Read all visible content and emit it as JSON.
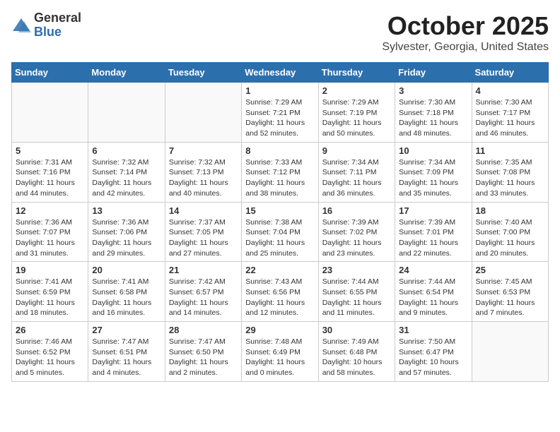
{
  "header": {
    "logo_general": "General",
    "logo_blue": "Blue",
    "month": "October 2025",
    "location": "Sylvester, Georgia, United States"
  },
  "weekdays": [
    "Sunday",
    "Monday",
    "Tuesday",
    "Wednesday",
    "Thursday",
    "Friday",
    "Saturday"
  ],
  "weeks": [
    [
      {
        "day": "",
        "info": ""
      },
      {
        "day": "",
        "info": ""
      },
      {
        "day": "",
        "info": ""
      },
      {
        "day": "1",
        "info": "Sunrise: 7:29 AM\nSunset: 7:21 PM\nDaylight: 11 hours and 52 minutes."
      },
      {
        "day": "2",
        "info": "Sunrise: 7:29 AM\nSunset: 7:19 PM\nDaylight: 11 hours and 50 minutes."
      },
      {
        "day": "3",
        "info": "Sunrise: 7:30 AM\nSunset: 7:18 PM\nDaylight: 11 hours and 48 minutes."
      },
      {
        "day": "4",
        "info": "Sunrise: 7:30 AM\nSunset: 7:17 PM\nDaylight: 11 hours and 46 minutes."
      }
    ],
    [
      {
        "day": "5",
        "info": "Sunrise: 7:31 AM\nSunset: 7:16 PM\nDaylight: 11 hours and 44 minutes."
      },
      {
        "day": "6",
        "info": "Sunrise: 7:32 AM\nSunset: 7:14 PM\nDaylight: 11 hours and 42 minutes."
      },
      {
        "day": "7",
        "info": "Sunrise: 7:32 AM\nSunset: 7:13 PM\nDaylight: 11 hours and 40 minutes."
      },
      {
        "day": "8",
        "info": "Sunrise: 7:33 AM\nSunset: 7:12 PM\nDaylight: 11 hours and 38 minutes."
      },
      {
        "day": "9",
        "info": "Sunrise: 7:34 AM\nSunset: 7:11 PM\nDaylight: 11 hours and 36 minutes."
      },
      {
        "day": "10",
        "info": "Sunrise: 7:34 AM\nSunset: 7:09 PM\nDaylight: 11 hours and 35 minutes."
      },
      {
        "day": "11",
        "info": "Sunrise: 7:35 AM\nSunset: 7:08 PM\nDaylight: 11 hours and 33 minutes."
      }
    ],
    [
      {
        "day": "12",
        "info": "Sunrise: 7:36 AM\nSunset: 7:07 PM\nDaylight: 11 hours and 31 minutes."
      },
      {
        "day": "13",
        "info": "Sunrise: 7:36 AM\nSunset: 7:06 PM\nDaylight: 11 hours and 29 minutes."
      },
      {
        "day": "14",
        "info": "Sunrise: 7:37 AM\nSunset: 7:05 PM\nDaylight: 11 hours and 27 minutes."
      },
      {
        "day": "15",
        "info": "Sunrise: 7:38 AM\nSunset: 7:04 PM\nDaylight: 11 hours and 25 minutes."
      },
      {
        "day": "16",
        "info": "Sunrise: 7:39 AM\nSunset: 7:02 PM\nDaylight: 11 hours and 23 minutes."
      },
      {
        "day": "17",
        "info": "Sunrise: 7:39 AM\nSunset: 7:01 PM\nDaylight: 11 hours and 22 minutes."
      },
      {
        "day": "18",
        "info": "Sunrise: 7:40 AM\nSunset: 7:00 PM\nDaylight: 11 hours and 20 minutes."
      }
    ],
    [
      {
        "day": "19",
        "info": "Sunrise: 7:41 AM\nSunset: 6:59 PM\nDaylight: 11 hours and 18 minutes."
      },
      {
        "day": "20",
        "info": "Sunrise: 7:41 AM\nSunset: 6:58 PM\nDaylight: 11 hours and 16 minutes."
      },
      {
        "day": "21",
        "info": "Sunrise: 7:42 AM\nSunset: 6:57 PM\nDaylight: 11 hours and 14 minutes."
      },
      {
        "day": "22",
        "info": "Sunrise: 7:43 AM\nSunset: 6:56 PM\nDaylight: 11 hours and 12 minutes."
      },
      {
        "day": "23",
        "info": "Sunrise: 7:44 AM\nSunset: 6:55 PM\nDaylight: 11 hours and 11 minutes."
      },
      {
        "day": "24",
        "info": "Sunrise: 7:44 AM\nSunset: 6:54 PM\nDaylight: 11 hours and 9 minutes."
      },
      {
        "day": "25",
        "info": "Sunrise: 7:45 AM\nSunset: 6:53 PM\nDaylight: 11 hours and 7 minutes."
      }
    ],
    [
      {
        "day": "26",
        "info": "Sunrise: 7:46 AM\nSunset: 6:52 PM\nDaylight: 11 hours and 5 minutes."
      },
      {
        "day": "27",
        "info": "Sunrise: 7:47 AM\nSunset: 6:51 PM\nDaylight: 11 hours and 4 minutes."
      },
      {
        "day": "28",
        "info": "Sunrise: 7:47 AM\nSunset: 6:50 PM\nDaylight: 11 hours and 2 minutes."
      },
      {
        "day": "29",
        "info": "Sunrise: 7:48 AM\nSunset: 6:49 PM\nDaylight: 11 hours and 0 minutes."
      },
      {
        "day": "30",
        "info": "Sunrise: 7:49 AM\nSunset: 6:48 PM\nDaylight: 10 hours and 58 minutes."
      },
      {
        "day": "31",
        "info": "Sunrise: 7:50 AM\nSunset: 6:47 PM\nDaylight: 10 hours and 57 minutes."
      },
      {
        "day": "",
        "info": ""
      }
    ]
  ]
}
